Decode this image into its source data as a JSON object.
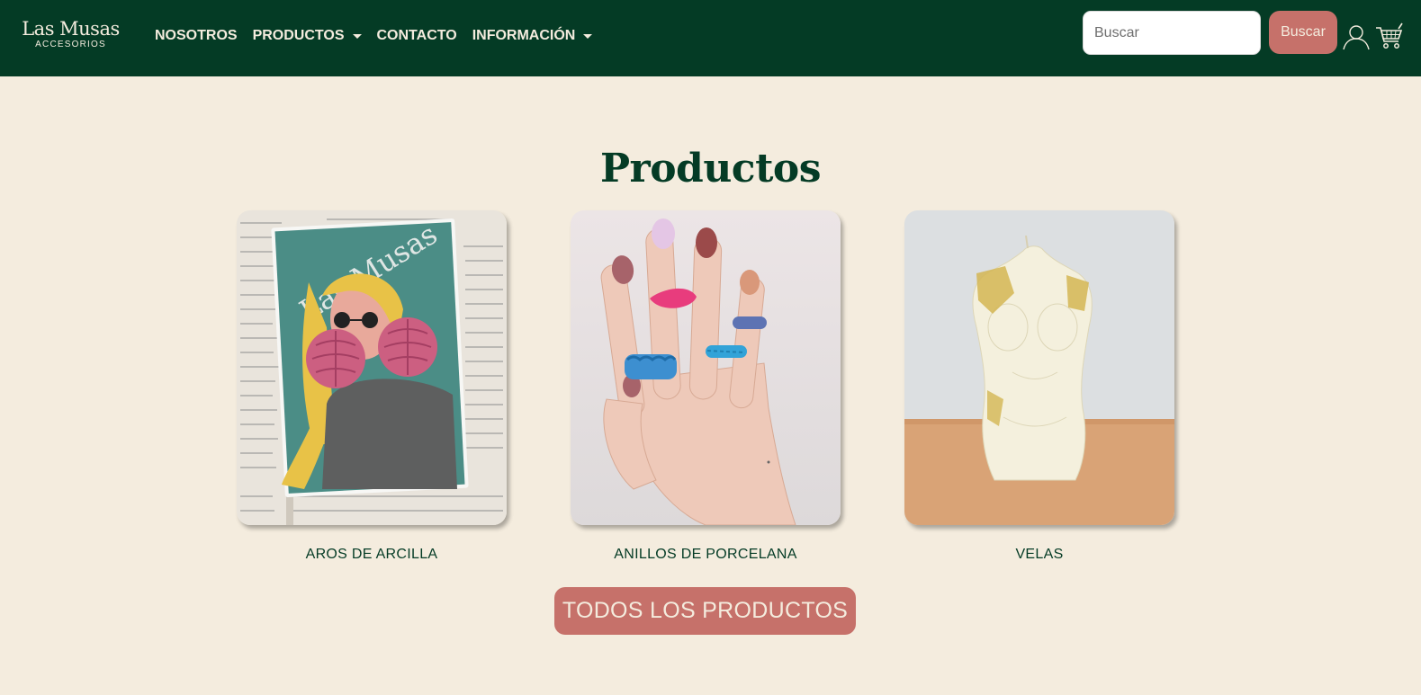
{
  "brand": {
    "name": "Las Musas",
    "subtitle": "ACCESORIOS"
  },
  "nav": [
    {
      "label": "NOSOTROS",
      "dropdown": false
    },
    {
      "label": "PRODUCTOS",
      "dropdown": true
    },
    {
      "label": "CONTACTO",
      "dropdown": false
    },
    {
      "label": "INFORMACIÓN",
      "dropdown": true
    }
  ],
  "search": {
    "placeholder": "Buscar",
    "value": "",
    "button_label": "Buscar"
  },
  "icons": {
    "user": "user-icon",
    "cart": "shopping-cart-icon"
  },
  "section": {
    "title": "Productos"
  },
  "products": [
    {
      "label": "AROS DE ARCILLA",
      "image_text": "Las Musas"
    },
    {
      "label": "ANILLOS DE PORCELANA"
    },
    {
      "label": "VELAS"
    }
  ],
  "cta": {
    "label": "TODOS LOS PRODUCTOS"
  },
  "colors": {
    "primary": "#043b25",
    "background": "#f4ecde",
    "accent": "#c6716a"
  }
}
